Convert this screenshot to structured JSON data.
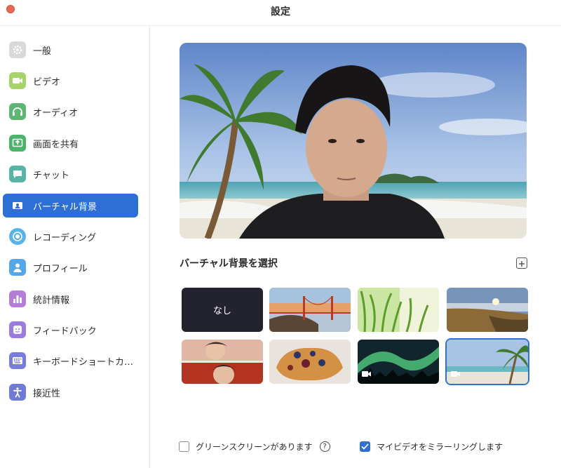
{
  "window": {
    "title": "設定"
  },
  "sidebar": {
    "items": [
      {
        "label": "一般",
        "icon": "gear-icon",
        "color": "#d9d9d9",
        "active": false
      },
      {
        "label": "ビデオ",
        "icon": "video-camera-icon",
        "color": "#a6d46a",
        "active": false
      },
      {
        "label": "オーディオ",
        "icon": "headphones-icon",
        "color": "#5fb672",
        "active": false
      },
      {
        "label": "画面を共有",
        "icon": "share-screen-icon",
        "color": "#4cb36a",
        "active": false
      },
      {
        "label": "チャット",
        "icon": "chat-bubble-icon",
        "color": "#57b5a8",
        "active": false
      },
      {
        "label": "バーチャル背景",
        "icon": "person-card-icon",
        "color": "#2d6fd4",
        "active": true
      },
      {
        "label": "レコーディング",
        "icon": "record-icon",
        "color": "#5ab4ec",
        "active": false
      },
      {
        "label": "プロフィール",
        "icon": "person-icon",
        "color": "#56a7e8",
        "active": false
      },
      {
        "label": "統計情報",
        "icon": "bar-chart-icon",
        "color": "#b47ed8",
        "active": false
      },
      {
        "label": "フィードバック",
        "icon": "smiley-icon",
        "color": "#9a7ce0",
        "active": false
      },
      {
        "label": "キーボードショートカ…",
        "icon": "keyboard-icon",
        "color": "#7a7cdb",
        "active": false
      },
      {
        "label": "接近性",
        "icon": "accessibility-icon",
        "color": "#6f7ad6",
        "active": false
      }
    ]
  },
  "main": {
    "section_title": "バーチャル背景を選択",
    "none_label": "なし",
    "backgrounds": [
      {
        "name": "none",
        "selected": false
      },
      {
        "name": "golden-gate-bridge",
        "selected": false
      },
      {
        "name": "grass",
        "selected": false
      },
      {
        "name": "coast-sunset",
        "selected": false
      },
      {
        "name": "person-photos",
        "selected": false
      },
      {
        "name": "pastry",
        "selected": false
      },
      {
        "name": "aurora-video",
        "selected": false
      },
      {
        "name": "beach-palm-video",
        "selected": true
      }
    ],
    "options": {
      "green_screen_label": "グリーンスクリーンがあります",
      "green_screen_checked": false,
      "help_symbol": "?",
      "mirror_label": "マイビデオをミラーリングします",
      "mirror_checked": true
    }
  },
  "colors": {
    "accent": "#2d6fd4",
    "close_button": "#e66a55"
  }
}
